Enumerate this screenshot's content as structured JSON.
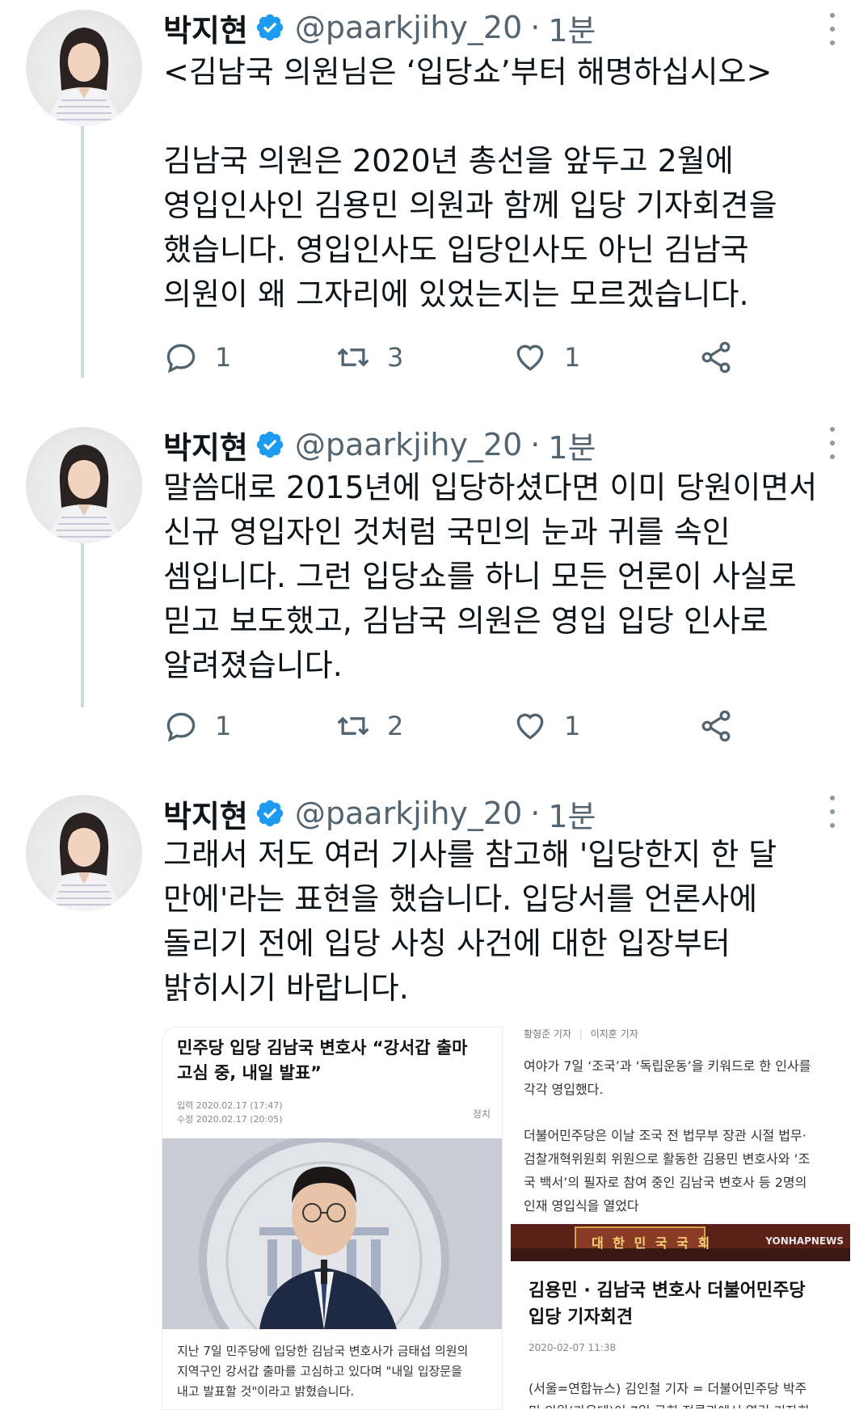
{
  "tweets": [
    {
      "name": "박지현",
      "handle": "@paarkjihy_20",
      "separator": "·",
      "time": "1분",
      "text": "<김남국 의원님은 ‘입당쇼’부터 해명하십시오>\n\n김남국 의원은 2020년 총선을 앞두고 2월에\n영입인사인 김용민 의원과 함께 입당 기자회견을\n했습니다. 영입인사도 입당인사도 아닌 김남국\n의원이 왜 그자리에 있었는지는 모르겠습니다.",
      "replies": "1",
      "retweets": "3",
      "likes": "1"
    },
    {
      "name": "박지현",
      "handle": "@paarkjihy_20",
      "separator": "·",
      "time": "1분",
      "text": "말씀대로 2015년에 입당하셨다면 이미 당원이면서\n신규 영입자인 것처럼 국민의 눈과 귀를 속인\n셈입니다. 그런 입당쇼를 하니 모든 언론이 사실로\n믿고 보도했고, 김남국 의원은 영입 입당 인사로\n알려졌습니다.",
      "replies": "1",
      "retweets": "2",
      "likes": "1"
    },
    {
      "name": "박지현",
      "handle": "@paarkjihy_20",
      "separator": "·",
      "time": "1분",
      "text": "그래서 저도 여러 기사를 참고해 '입당한지 한 달\n만에'라는 표현을 했습니다. 입당서를 언론사에\n돌리기 전에 입당 사칭 사건에 대한 입장부터\n밝히시기 바랍니다."
    }
  ],
  "media": {
    "left": {
      "headline": "민주당 입당 김남국 변호사 “강서갑 출마\n고심 중, 내일 발표”",
      "date_input": "입력 2020.02.17 (17:47)",
      "date_modified": "수정 2020.02.17 (20:05)",
      "section": "정치",
      "caption": "지난 7일 민주당에 입당한 김남국 변호사가 금태섭 의원의\n지역구인 강서갑 출마를 고심하고 있다며 \"내일 입장문을\n내고 발표할 것\"이라고 밝혔습니다."
    },
    "right_top": {
      "byline1": "황형준 기자",
      "byline2": "이지훈 기자",
      "para1": "여야가 7일 ‘조국’과 ‘독립운동’을 키워드로 한 인사를\n각각 영입했다.",
      "para2": "더불어민주당은 이날 조국 전 법무부 장관 시절 법무·\n검찰개혁위원회 위원으로 활동한 김용민 변호사와 ‘조\n국 백서’의 필자로 참여 중인 김남국 변호사 등 2명의\n인재 영입식을 열었다"
    },
    "right_bottom": {
      "banner_text": "대 한 민 국 국 회",
      "logo": "YONHAPNEWS",
      "headline": "김용민 · 김남국 변호사 더불어민주당\n입당 기자회견",
      "date": "2020-02-07 11:38",
      "para": "(서울=연합뉴스) 김인철 기자 = 더불어민주당 박주\n민 의원(가운데)이 7일 국회 정론관에서 열린 기자회"
    }
  },
  "colors": {
    "verified": "#1d9bf0",
    "muted": "#536471",
    "thread_line": "#cfd9de"
  }
}
